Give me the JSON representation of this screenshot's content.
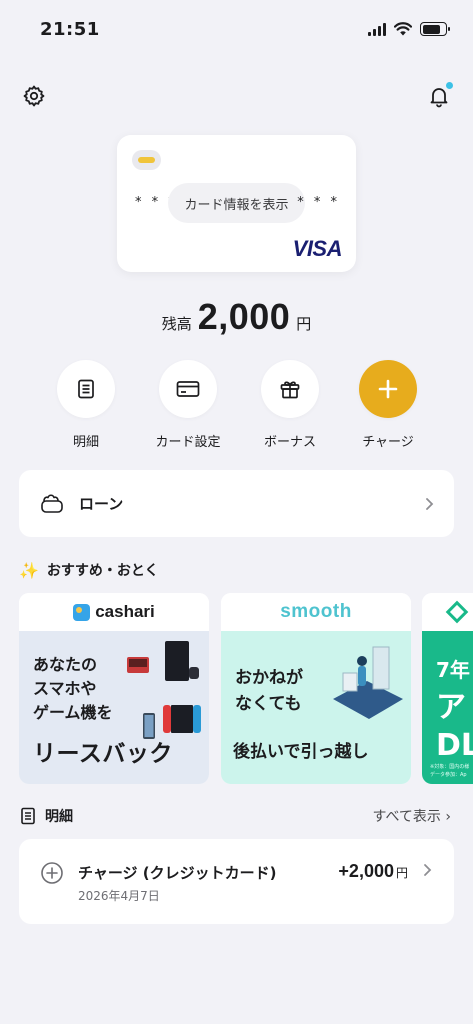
{
  "status": {
    "time": "21:51"
  },
  "card": {
    "mask_left": "* * *",
    "mask_right": "* * *",
    "show_info": "カード情報を表示",
    "brand": "VISA"
  },
  "balance": {
    "label": "残高",
    "amount": "2,000",
    "unit": "円"
  },
  "actions": [
    {
      "label": "明細",
      "icon": "document-icon"
    },
    {
      "label": "カード設定",
      "icon": "card-icon"
    },
    {
      "label": "ボーナス",
      "icon": "gift-icon"
    },
    {
      "label": "チャージ",
      "icon": "plus-icon"
    }
  ],
  "loan": {
    "label": "ローン",
    "icon": "wallet-icon"
  },
  "recommend": {
    "title": "おすすめ・おとく",
    "banners": [
      {
        "brand": "cashari",
        "text1": "あなたの",
        "text2": "スマホや",
        "text3": "ゲーム機を",
        "headline": "リースバック"
      },
      {
        "brand": "smooth",
        "text1": "おかねが",
        "text2": "なくても",
        "headline": "後払いで引っ越し"
      },
      {
        "text1": "7年",
        "text2": "ア",
        "text3": "DL",
        "note": "※対象：国内の様 データ参加：Ap"
      }
    ]
  },
  "history": {
    "title": "明細",
    "see_all": "すべて表示",
    "items": [
      {
        "title": "チャージ (クレジットカード)",
        "date": "2026年4月7日",
        "amount": "+2,000",
        "unit": "円"
      }
    ]
  },
  "colors": {
    "accent": "#e7ac1d",
    "notification": "#3cc1e6"
  }
}
